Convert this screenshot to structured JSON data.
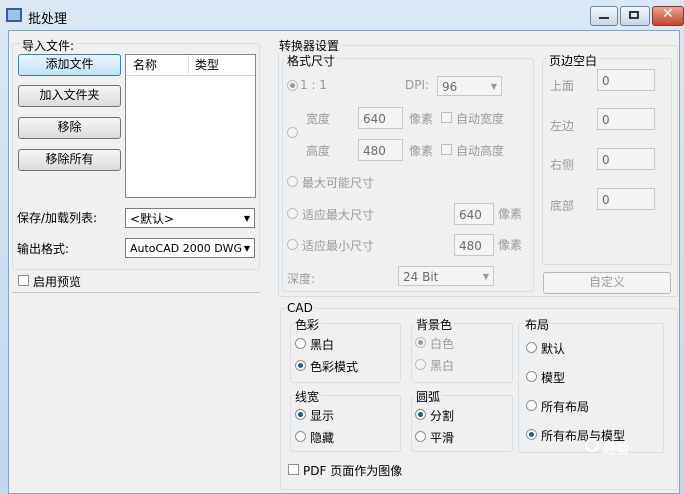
{
  "window": {
    "title": "批处理"
  },
  "import": {
    "group_label": "导入文件:",
    "add_file": "添加文件",
    "add_folder": "加入文件夹",
    "remove": "移除",
    "remove_all": "移除所有",
    "columns": [
      "名称",
      "类型"
    ]
  },
  "save_list": {
    "label": "保存/加载列表:",
    "value": "<默认>"
  },
  "output_format": {
    "label": "输出格式:",
    "value": "AutoCAD 2000 DWG"
  },
  "preview": {
    "label": "启用预览"
  },
  "converter": {
    "group_label": "转换器设置",
    "format_size": {
      "label": "格式尺寸",
      "ratio_label": "1 : 1",
      "dpi_label": "DPI:",
      "dpi_value": "96",
      "width_label": "宽度",
      "width_value": "640",
      "width_unit": "像素",
      "auto_width": "自动宽度",
      "height_label": "高度",
      "height_value": "480",
      "height_unit": "像素",
      "auto_height": "自动高度",
      "max_size": "最大可能尺寸",
      "fit_max": "适应最大尺寸",
      "fit_max_value": "640",
      "fit_max_unit": "像素",
      "fit_min": "适应最小尺寸",
      "fit_min_value": "480",
      "fit_min_unit": "像素",
      "depth_label": "深度:",
      "depth_value": "24 Bit"
    },
    "margins": {
      "label": "页边空白",
      "top_label": "上面",
      "top_value": "0",
      "left_label": "左边",
      "left_value": "0",
      "right_label": "右侧",
      "right_value": "0",
      "bottom_label": "底部",
      "bottom_value": "0"
    },
    "customize": "自定义"
  },
  "cad": {
    "group_label": "CAD",
    "color": {
      "label": "色彩",
      "opt1": "黑白",
      "opt2": "色彩模式"
    },
    "background": {
      "label": "背景色",
      "opt1": "白色",
      "opt2": "黑白"
    },
    "layout": {
      "label": "布局",
      "opt1": "默认",
      "opt2": "模型",
      "opt3": "所有布局",
      "opt4": "所有布局与模型"
    },
    "line_width": {
      "label": "线宽",
      "opt1": "显示",
      "opt2": "隐藏"
    },
    "arc": {
      "label": "圆弧",
      "opt1": "分割",
      "opt2": "平滑"
    },
    "pdf_as_image": "PDF 页面作为图像"
  },
  "watermark": "经验"
}
